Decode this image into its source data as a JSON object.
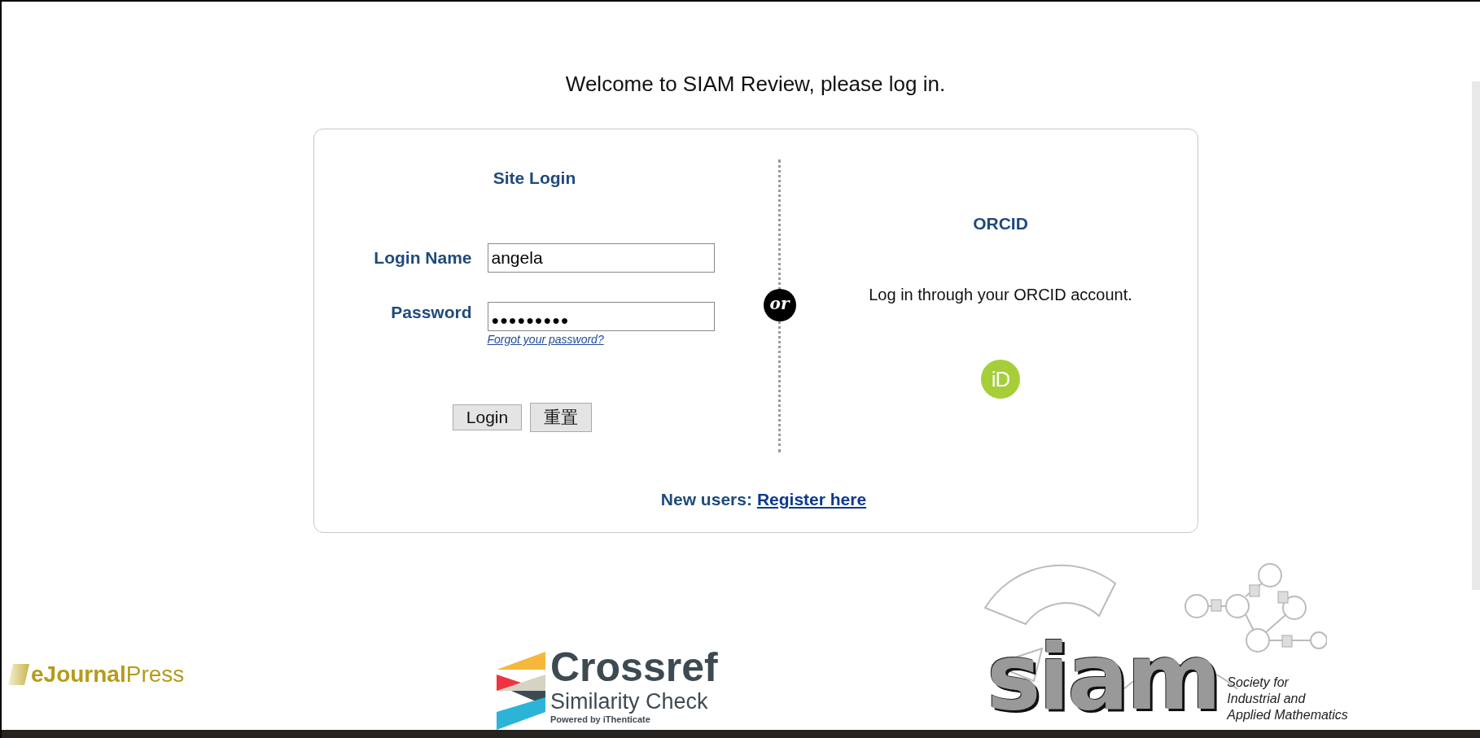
{
  "heading": "Welcome to SIAM Review, please log in.",
  "site_login": {
    "title": "Site Login",
    "fields": [
      {
        "label": "Login Name",
        "value": "angela",
        "kind": "text"
      },
      {
        "label": "Password",
        "value": "●●●●●●●●●",
        "kind": "password"
      }
    ],
    "forgot_link": "Forgot your password?",
    "buttons": [
      "Login",
      "重置"
    ]
  },
  "divider_label": "or",
  "orcid": {
    "title": "ORCID",
    "text": "Log in through your ORCID account.",
    "icon_text": "iD"
  },
  "register": {
    "prefix": "New users:",
    "link": "Register here"
  },
  "footer_logos": {
    "ejournalpress": "**eJournal**Press",
    "crossref": {
      "name": "Crossref",
      "product": "Similarity Check",
      "powered_by": "Powered by iThenticate"
    },
    "siam": {
      "wordmark": "siam",
      "tagline": [
        "Society for",
        "Industrial and",
        "Applied Mathematics"
      ]
    }
  }
}
